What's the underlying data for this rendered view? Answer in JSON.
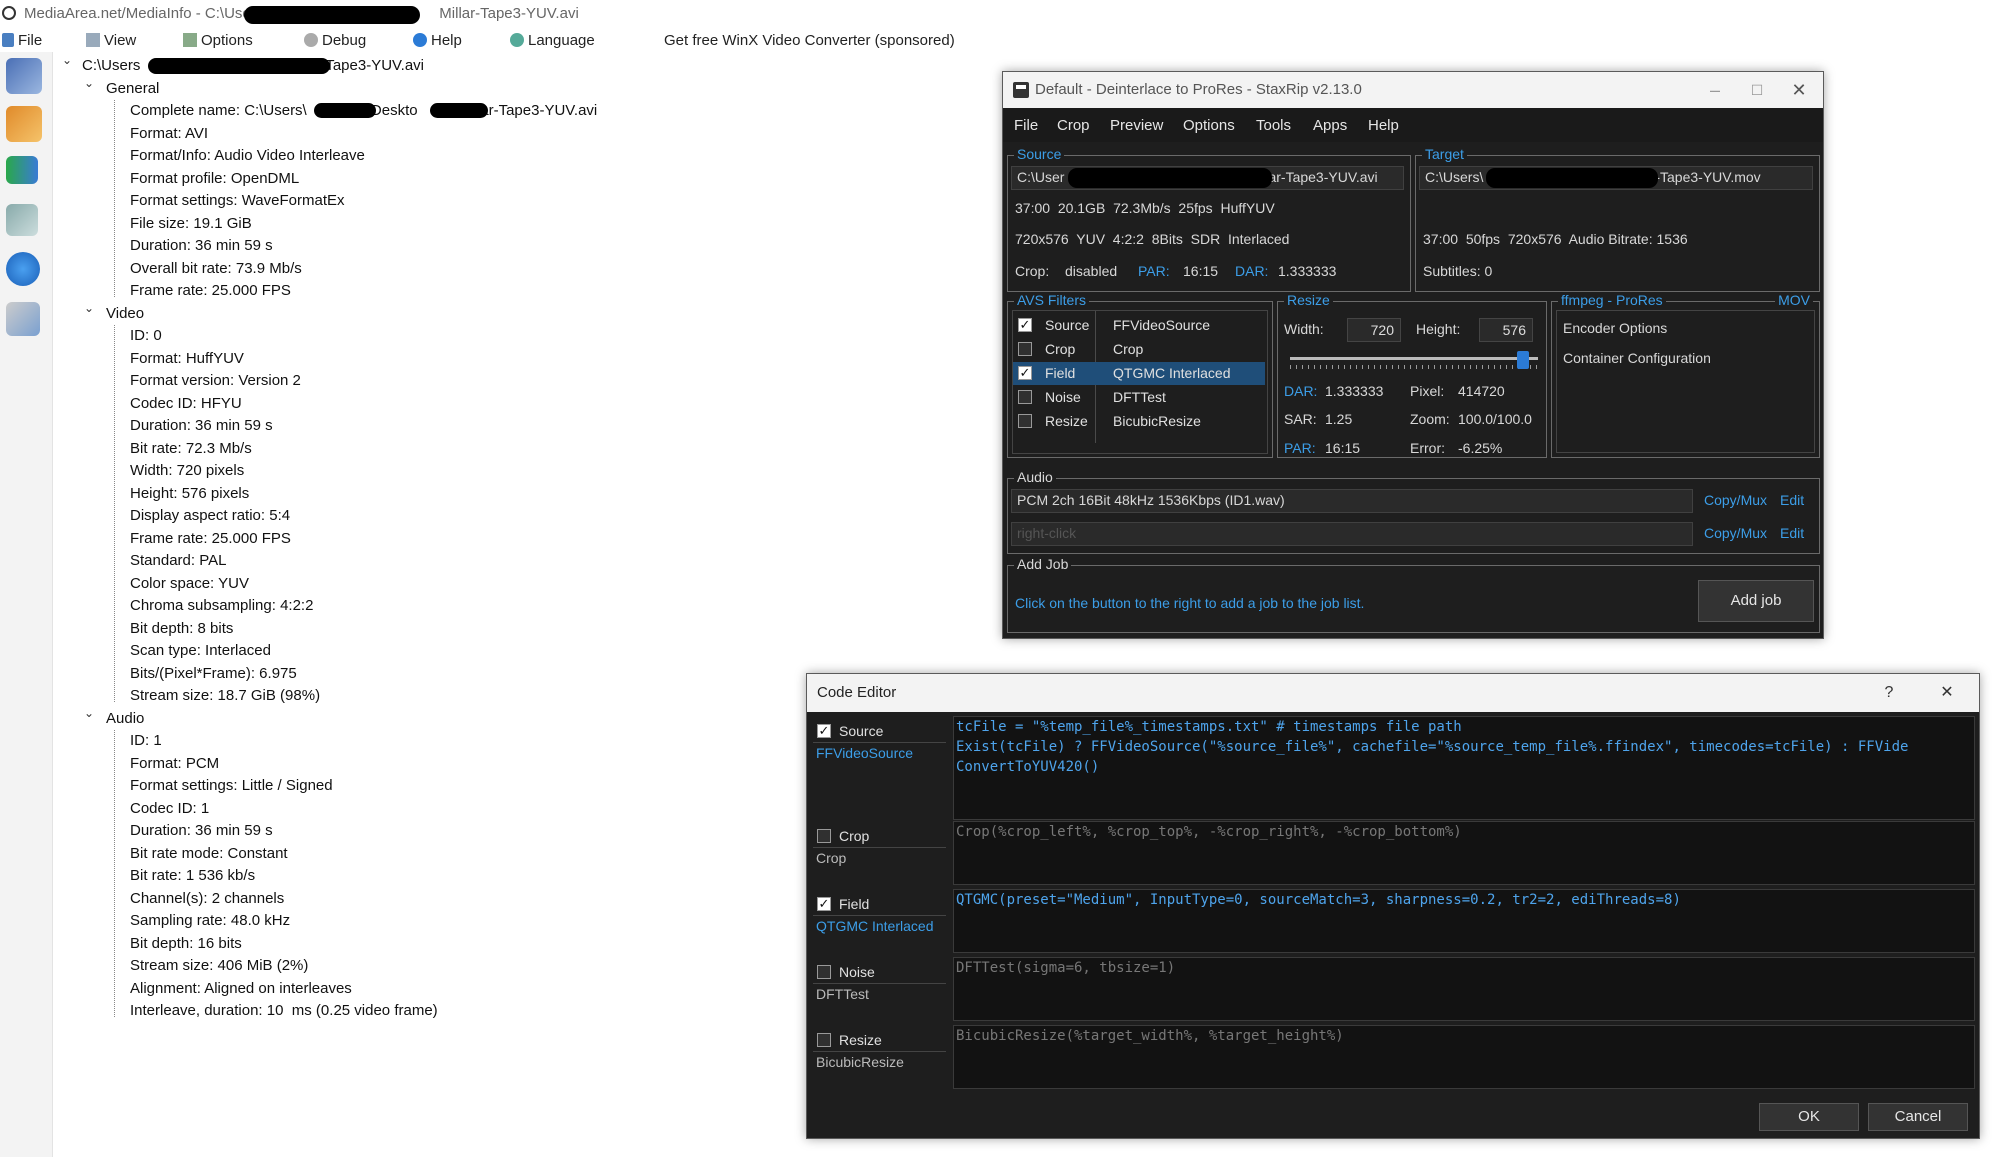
{
  "mediainfo": {
    "title_prefix": "MediaArea.net/MediaInfo - C:\\Users",
    "title_suffix": "Millar-Tape3-YUV.avi",
    "menu": {
      "file": "File",
      "view": "View",
      "options": "Options",
      "debug": "Debug",
      "help": "Help",
      "language": "Language",
      "sponsored": "Get free WinX Video Converter (sponsored)"
    },
    "toolbar_icons": [
      "open-file-icon",
      "open-folder-icon",
      "export-icon",
      "preferences-icon",
      "about-icon",
      "knowledge-base-icon"
    ],
    "root_prefix": "C:\\Users",
    "root_suffix": "-Tape3-YUV.avi",
    "sections": [
      {
        "name": "General",
        "rows": [
          "Complete name: C:\\Users\\",
          "Format: AVI",
          "Format/Info: Audio Video Interleave",
          "Format profile: OpenDML",
          "Format settings: WaveFormatEx",
          "File size: 19.1 GiB",
          "Duration: 36 min 59 s",
          "Overall bit rate: 73.9 Mb/s",
          "Frame rate: 25.000 FPS"
        ]
      },
      {
        "name": "Video",
        "rows": [
          "ID: 0",
          "Format: HuffYUV",
          "Format version: Version 2",
          "Codec ID: HFYU",
          "Duration: 36 min 59 s",
          "Bit rate: 72.3 Mb/s",
          "Width: 720 pixels",
          "Height: 576 pixels",
          "Display aspect ratio: 5:4",
          "Frame rate: 25.000 FPS",
          "Standard: PAL",
          "Color space: YUV",
          "Chroma subsampling: 4:2:2",
          "Bit depth: 8 bits",
          "Scan type: Interlaced",
          "Bits/(Pixel*Frame): 6.975",
          "Stream size: 18.7 GiB (98%)"
        ]
      },
      {
        "name": "Audio",
        "rows": [
          "ID: 1",
          "Format: PCM",
          "Format settings: Little / Signed",
          "Codec ID: 1",
          "Duration: 36 min 59 s",
          "Bit rate mode: Constant",
          "Bit rate: 1 536 kb/s",
          "Channel(s): 2 channels",
          "Sampling rate: 48.0 kHz",
          "Bit depth: 16 bits",
          "Stream size: 406 MiB (2%)",
          "Alignment: Aligned on interleaves",
          "Interleave, duration: 10  ms (0.25 video frame)"
        ]
      }
    ],
    "complete_name_mid": "\\Deskto",
    "complete_name_end": "llar-Tape3-YUV.avi"
  },
  "staxrip": {
    "title": "Default - Deinterlace to ProRes - StaxRip v2.13.0",
    "menu": [
      "File",
      "Crop",
      "Preview",
      "Options",
      "Tools",
      "Apps",
      "Help"
    ],
    "source": {
      "legend": "Source",
      "path_prefix": "C:\\User",
      "path_suffix": "ar-Tape3-YUV.avi",
      "line1": "37:00  20.1GB  72.3Mb/s  25fps  HuffYUV",
      "line2": "720x576  YUV  4:2:2  8Bits  SDR  Interlaced",
      "crop_label": "Crop:",
      "crop_value": "disabled",
      "par_label": "PAR:",
      "par_value": "16:15",
      "dar_label": "DAR:",
      "dar_value": "1.333333"
    },
    "target": {
      "legend": "Target",
      "path_prefix": "C:\\Users\\",
      "path_suffix": "-Tape3-YUV.mov",
      "line1": "37:00  50fps  720x576  Audio Bitrate: 1536",
      "subtitles": "Subtitles: 0"
    },
    "avs_filters": {
      "legend": "AVS Filters",
      "rows": [
        {
          "category": "Source",
          "name": "FFVideoSource",
          "checked": true,
          "mark": "✓"
        },
        {
          "category": "Crop",
          "name": "Crop",
          "checked": false,
          "mark": ""
        },
        {
          "category": "Field",
          "name": "QTGMC Interlaced",
          "checked": true,
          "mark": "✓"
        },
        {
          "category": "Noise",
          "name": "DFTTest",
          "checked": false,
          "mark": ""
        },
        {
          "category": "Resize",
          "name": "BicubicResize",
          "checked": false,
          "mark": ""
        }
      ]
    },
    "resize": {
      "legend": "Resize",
      "width_label": "Width:",
      "width_value": "720",
      "height_label": "Height:",
      "height_value": "576",
      "slider_level": 0.96,
      "dar_label": "DAR:",
      "dar_value": "1.333333",
      "pixel_label": "Pixel:",
      "pixel_value": "414720",
      "sar_label": "SAR:",
      "sar_value": "1.25",
      "zoom_label": "Zoom:",
      "zoom_value": "100.0/100.0",
      "par_label": "PAR:",
      "par_value": "16:15",
      "error_label": "Error:",
      "error_value": "-6.25%"
    },
    "encoder": {
      "legend": "ffmpeg - ProRes",
      "container": "MOV",
      "options": "Encoder Options",
      "container_config": "Container Configuration"
    },
    "audio": {
      "legend": "Audio",
      "track1": "PCM 2ch 16Bit 48kHz 1536Kbps (ID1.wav)",
      "track2_placeholder": "right-click",
      "copymux": "Copy/Mux",
      "edit": "Edit"
    },
    "addjob": {
      "legend": "Add Job",
      "hint": "Click on the button to the right to add a job to the job list.",
      "button": "Add job"
    }
  },
  "code_editor": {
    "title": "Code Editor",
    "help_glyph": "?",
    "close_glyph": "✕",
    "rows": [
      {
        "category": "Source",
        "filter": "FFVideoSource",
        "checked": true,
        "mark": "✓",
        "code": "tcFile = \"%temp_file%_timestamps.txt\" # timestamps file path\nExist(tcFile) ? FFVideoSource(\"%source_file%\", cachefile=\"%source_temp_file%.ffindex\", timecodes=tcFile) : FFVide\nConvertToYUV420()"
      },
      {
        "category": "Crop",
        "filter": "Crop",
        "checked": false,
        "mark": "",
        "code": "Crop(%crop_left%, %crop_top%, -%crop_right%, -%crop_bottom%)"
      },
      {
        "category": "Field",
        "filter": "QTGMC Interlaced",
        "checked": true,
        "mark": "✓",
        "code": "QTGMC(preset=\"Medium\", InputType=0, sourceMatch=3, sharpness=0.2, tr2=2, ediThreads=8)"
      },
      {
        "category": "Noise",
        "filter": "DFTTest",
        "checked": false,
        "mark": "",
        "code": "DFTTest(sigma=6, tbsize=1)"
      },
      {
        "category": "Resize",
        "filter": "BicubicResize",
        "checked": false,
        "mark": "",
        "code": "BicubicResize(%target_width%, %target_height%)"
      }
    ],
    "ok": "OK",
    "cancel": "Cancel"
  }
}
